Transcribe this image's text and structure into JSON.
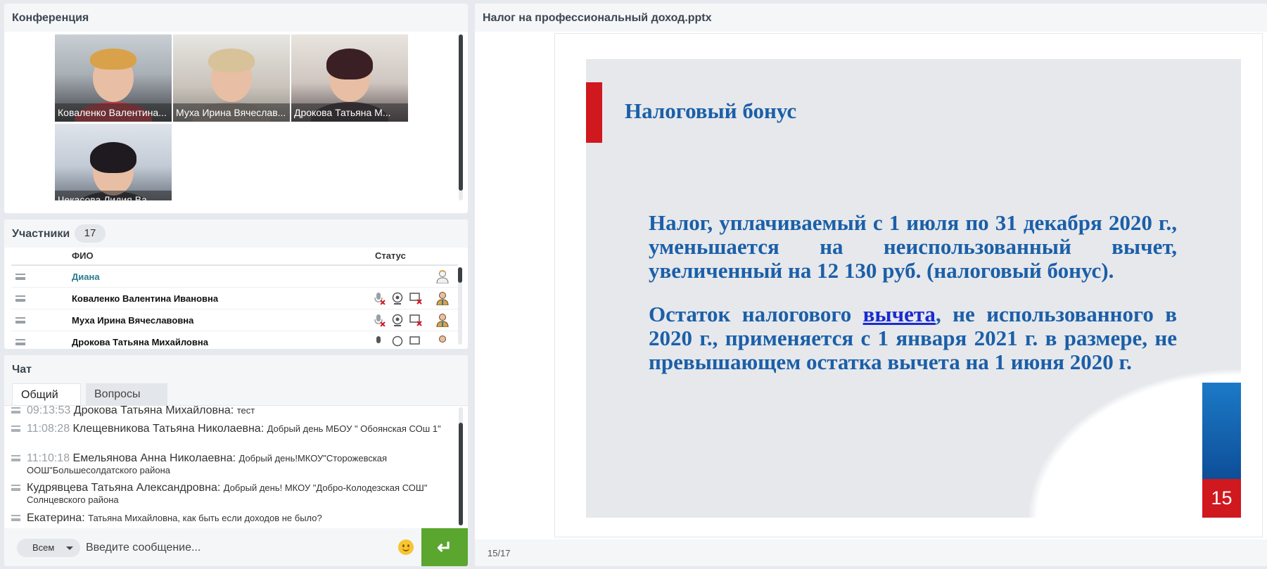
{
  "conference": {
    "title": "Конференция",
    "videos": [
      {
        "name": "Коваленко Валентина..."
      },
      {
        "name": "Муха Ирина Вячеслав..."
      },
      {
        "name": "Дрокова  Татьяна   М..."
      },
      {
        "name": "Чекасова Лидия  Ва..."
      }
    ]
  },
  "participants": {
    "title": "Участники",
    "count": "17",
    "col_name": "ФИО",
    "col_status": "Статус",
    "rows": [
      {
        "name": "Диана"
      },
      {
        "name": "Коваленко Валентина  Ивановна"
      },
      {
        "name": "Муха Ирина Вячеславовна"
      },
      {
        "name": "Дрокова  Татьяна   Михайловна"
      }
    ]
  },
  "chat": {
    "title": "Чат",
    "tab_general": "Общий",
    "tab_questions": "Вопросы",
    "messages": [
      {
        "time": "09:13:53",
        "author": "Дрокова  Татьяна   Михайловна:",
        "text": "тест"
      },
      {
        "time": "11:08:28",
        "author": "Клещевникова Татьяна  Николаевна:",
        "text": "Добрый день МБОУ \" Обоянская СОш 1\""
      },
      {
        "time": "11:10:18",
        "author": "Емельянова Анна   Николаевна:",
        "text": "Добрый день!МКОУ\"Сторожевская ООШ\"Большесолдатского района"
      },
      {
        "time": "",
        "author": "Кудрявцева Татьяна  Александровна:",
        "text": "Добрый день! МКОУ \"Добро-Колодезская СОШ\" Солнцевского района"
      },
      {
        "time": "",
        "author": "Екатерина:",
        "text": "Татьяна Михайловна, как быть если доходов не было?"
      }
    ],
    "recipient": "Всем",
    "input_placeholder": "Введите сообщение...",
    "send_glyph": "↵"
  },
  "presentation": {
    "title": "Налог на профессиональный доход.pptx",
    "page_counter": "15/17",
    "slide": {
      "title": "Налоговый бонус",
      "para1": "Налог, уплачиваемый с 1 июля по 31 декабря 2020 г., уменьшается на неиспользованный вычет, увеличенный на 12 130 руб. (налоговый бонус).",
      "para2_start": "Остаток налогового ",
      "para2_link": "вычета",
      "para2_end": ", не использованного в 2020 г., применяется с 1 января 2021 г. в размере, не превышающем остатка вычета на 1 июня 2020 г.",
      "number": "15"
    }
  },
  "colors": {
    "accent_green": "#5aa62e",
    "slide_blue": "#1b5fa8",
    "slide_red": "#d0181f"
  }
}
